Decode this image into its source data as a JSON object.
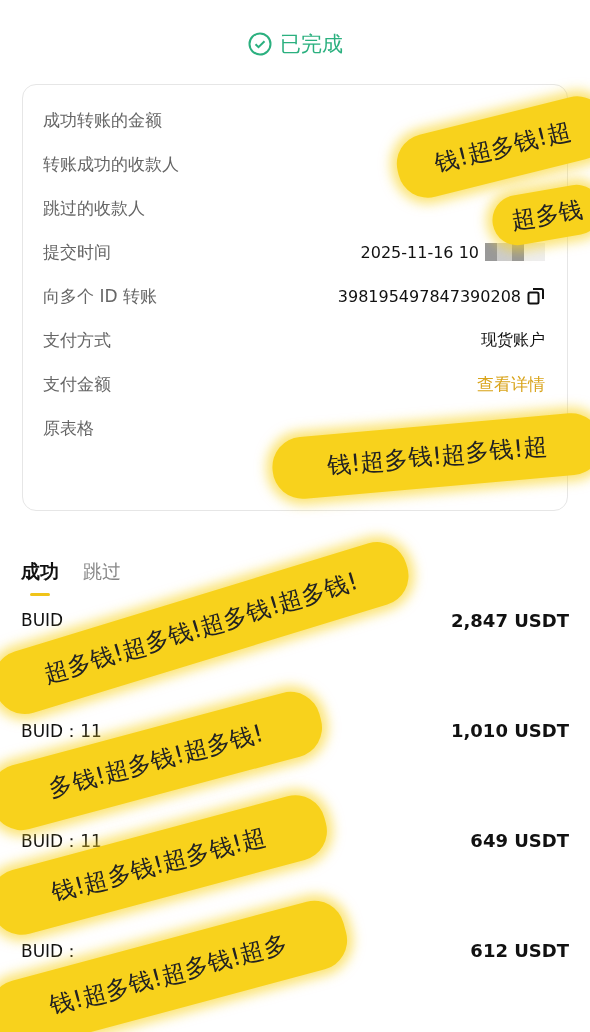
{
  "status": {
    "text": "已完成"
  },
  "details": [
    {
      "label": "成功转账的金额",
      "kind": "plain"
    },
    {
      "label": "转账成功的收款人",
      "kind": "plain"
    },
    {
      "label": "跳过的收款人",
      "kind": "plain"
    },
    {
      "label": "提交时间",
      "kind": "redacted",
      "value": "2025-11-16 10"
    },
    {
      "label": "向多个 ID 转账",
      "kind": "copy",
      "value": "398195497847390208"
    },
    {
      "label": "支付方式",
      "kind": "plain",
      "value": "现货账户"
    },
    {
      "label": "支付金额",
      "kind": "link",
      "value": "查看详情"
    },
    {
      "label": "原表格",
      "kind": "plain"
    }
  ],
  "tabs": [
    {
      "label": "成功",
      "selected": true
    },
    {
      "label": "跳过",
      "selected": false
    }
  ],
  "rows": [
    {
      "buid": "BUID",
      "amount": "2,847 USDT"
    },
    {
      "buid": "BUID：11",
      "amount": "1,010 USDT"
    },
    {
      "buid": "BUID：11",
      "amount": "649 USDT"
    },
    {
      "buid": "BUID：",
      "amount": "612 USDT"
    }
  ],
  "stickers": [
    {
      "text": "钱!超多钱!超"
    },
    {
      "text": "超多钱"
    },
    {
      "text": "钱!超多钱!超多钱!超"
    },
    {
      "text": "超多钱!超多钱!超多钱!超多钱!"
    },
    {
      "text": "多钱!超多钱!超多钱!"
    },
    {
      "text": "钱!超多钱!超多钱!超"
    },
    {
      "text": "钱!超多钱!超多钱!超多"
    }
  ]
}
